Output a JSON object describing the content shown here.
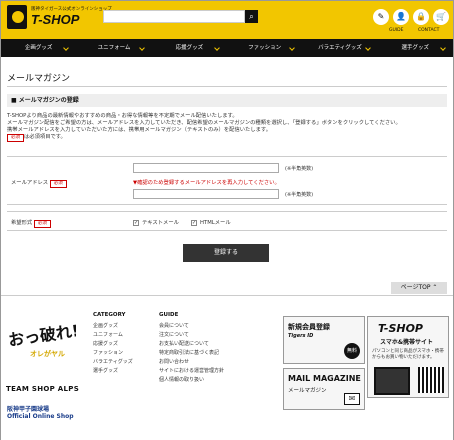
{
  "header": {
    "tagline": "阪神タイガース公式オンラインショップ",
    "shop_name": "T-SHOP",
    "search_value": "",
    "links": [
      "GUIDE",
      "CONTACT"
    ]
  },
  "nav": [
    "企画グッズ",
    "ユニフォーム",
    "応援グッズ",
    "ファッション",
    "バラエティグッズ",
    "選手グッズ"
  ],
  "page_title": "メールマガジン",
  "section_title": "■ メールマガジンの登録",
  "intro": {
    "line1": "T-SHOPより商品の最新情報やおすすめの商品・お得な情報等を不定期でメール配信いたします。",
    "line2": "メールマガジン配信をご希望の方は、メールアドレスを入力していただき、配信希望のメールマガジンの種類を選択し、「登録する」ボタンをクリックしてください。",
    "line3": "携帯メールアドレスを入力していただいた方には、携帯用メールマガジン（テキストのみ）を配信いたします。",
    "required_badge": "必須",
    "required_note": "は必須項目です。"
  },
  "form": {
    "email_label": "メールアドレス",
    "email_value": "",
    "email_confirm_value": "",
    "note_halfwidth": "(※半角英数)",
    "confirm_warning": "▼確認のため登録するメールアドレスを再入力してください。",
    "format_label": "希望形式",
    "option_text": "テキストメール",
    "option_html": "HTMLメール",
    "submit_label": "登録する"
  },
  "pagetop_label": "ページTOP ⌃",
  "footer": {
    "logo_text": "おっ破れ!",
    "logo_sub": "オレがヤル",
    "alps": "TEAM SHOP ALPS",
    "koshien_line1": "阪神甲子園球場",
    "koshien_line2": "Official Online Shop",
    "category_title": "CATEGORY",
    "category_items": [
      "企画グッズ",
      "ユニフォーム",
      "応援グッズ",
      "ファッション",
      "バラエティグッズ",
      "選手グッズ"
    ],
    "guide_title": "GUIDE",
    "guide_items": [
      "会員について",
      "注文について",
      "お支払い配送について",
      "特定商取引法に基づく表記",
      "お問い合わせ",
      "サイトにおける運営管理方針",
      "個人情報の取り扱い"
    ],
    "banner_member_title": "新規会員登録",
    "banner_member_sub": "Tigers ID",
    "banner_free": "無料",
    "banner_mobile_title": "T-SHOP",
    "banner_mobile_sub": "スマホ&携帯サイト",
    "banner_mobile_note": "パソコンと同じ商品がスマホ・携帯からもお買い物いただけます。",
    "banner_mail_title": "MAIL MAGAZINE",
    "banner_mail_sub": "メールマガジン"
  }
}
